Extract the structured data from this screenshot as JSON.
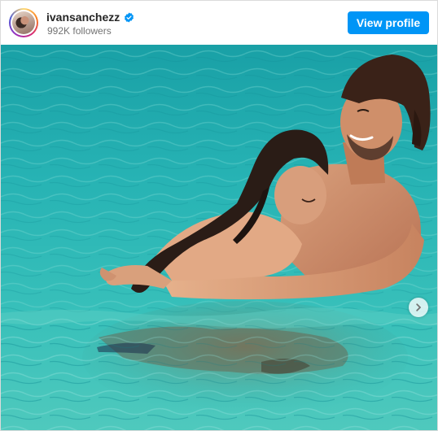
{
  "header": {
    "username": "ivansanchezz",
    "verified": true,
    "followers": "992K followers",
    "view_profile_label": "View profile"
  },
  "post": {
    "image_alt": "",
    "carousel": {
      "next_icon": "chevron-right-icon"
    }
  },
  "colors": {
    "accent": "#0095f6",
    "verified_badge": "#0095f6",
    "username": "#262626",
    "secondary_text": "#737373"
  }
}
